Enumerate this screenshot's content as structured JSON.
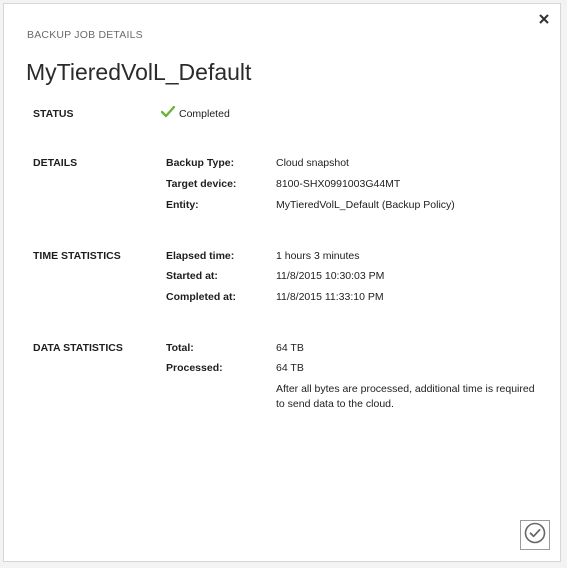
{
  "dialog": {
    "caption": "BACKUP JOB DETAILS",
    "title": "MyTieredVolL_Default"
  },
  "icons": {
    "close": "close-icon",
    "status": "checkmark-icon",
    "confirm": "checkmark-circle-icon"
  },
  "colors": {
    "status_ok": "#6cb33e"
  },
  "status": {
    "label": "STATUS",
    "value": "Completed"
  },
  "details": {
    "label": "DETAILS",
    "rows": [
      {
        "key": "Backup Type:",
        "value": "Cloud snapshot"
      },
      {
        "key": "Target device:",
        "value": "8100-SHX0991003G44MT"
      },
      {
        "key": "Entity:",
        "value": "MyTieredVolL_Default (Backup Policy)"
      }
    ]
  },
  "time_statistics": {
    "label": "TIME STATISTICS",
    "rows": [
      {
        "key": "Elapsed time:",
        "value": "1 hours 3 minutes"
      },
      {
        "key": "Started at:",
        "value": "11/8/2015 10:30:03 PM"
      },
      {
        "key": "Completed at:",
        "value": "11/8/2015 11:33:10 PM"
      }
    ]
  },
  "data_statistics": {
    "label": "DATA STATISTICS",
    "rows": [
      {
        "key": "Total:",
        "value": "64 TB"
      },
      {
        "key": "Processed:",
        "value": "64 TB"
      }
    ],
    "note": "After all bytes are processed, additional time is required to send data to the cloud."
  }
}
